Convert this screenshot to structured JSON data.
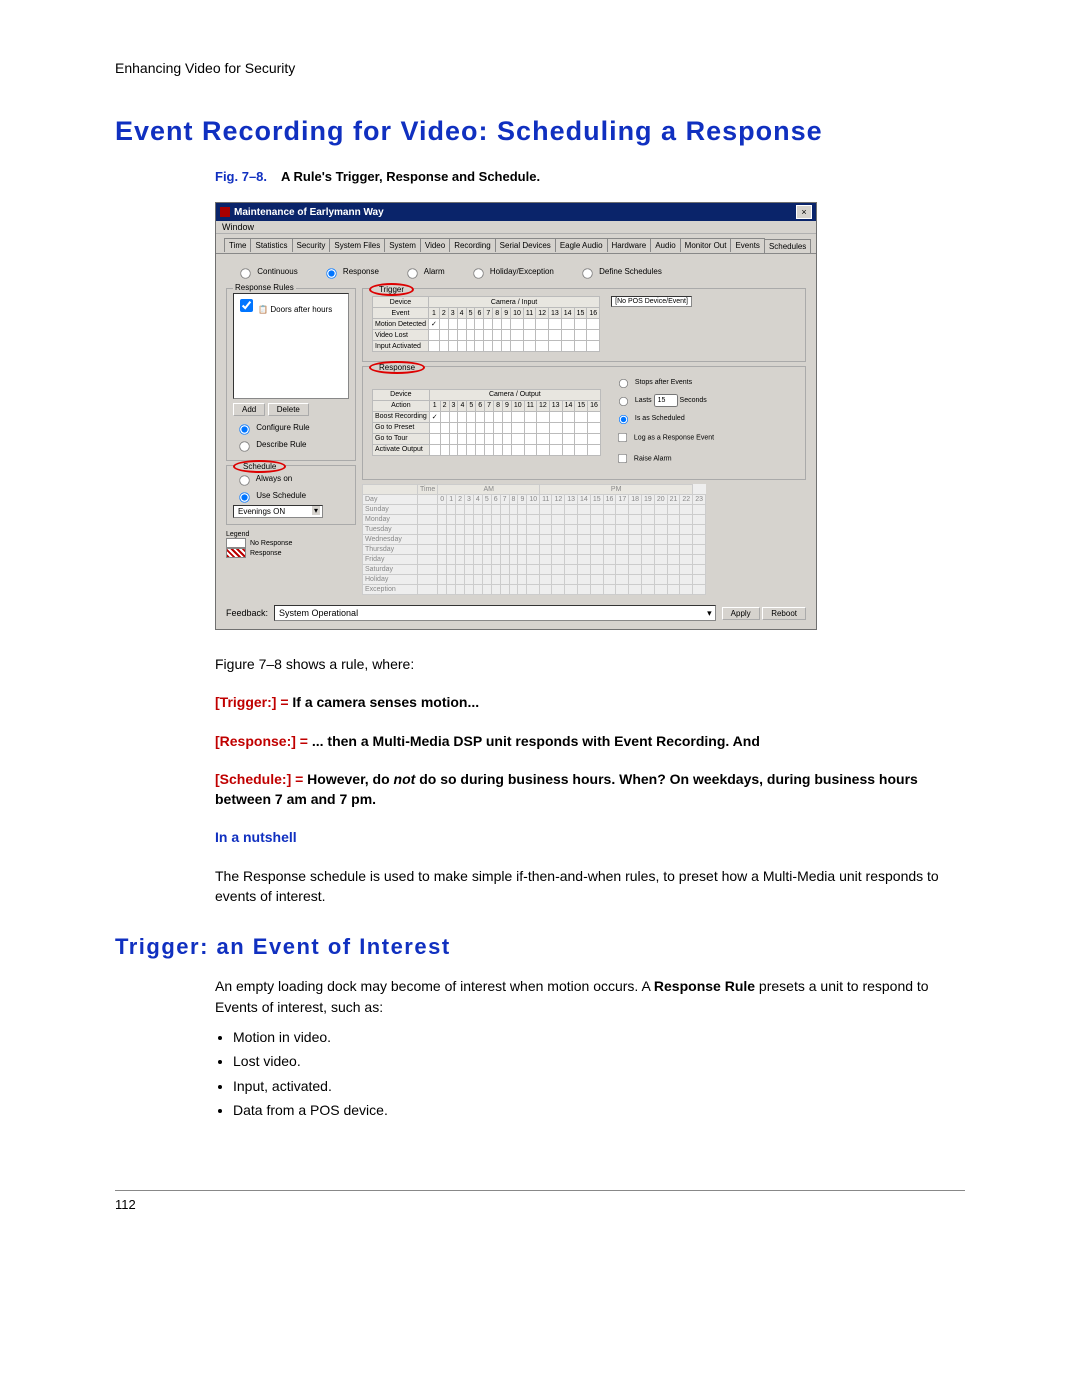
{
  "doc": {
    "header": "Enhancing Video for Security",
    "page_number": "112",
    "h1": "Event Recording for Video: Scheduling a Response",
    "fig_label": "Fig. 7–8.",
    "fig_title": "A Rule's Trigger, Response and Schedule.",
    "intro_line": "Figure 7–8 shows a rule, where:",
    "trigger_label": "[Trigger:] =",
    "trigger_text": " If a camera senses motion...",
    "response_label": "[Response:] =",
    "response_text": " ... then a Multi-Media DSP unit responds with Event Recording. And",
    "schedule_label": "[Schedule:] =",
    "schedule_text_before": " However, do ",
    "schedule_not": "not",
    "schedule_text_after": " do so during business hours. When? On weekdays, during business hours between 7 am and 7 pm.",
    "nutshell_heading": "In a nutshell",
    "nutshell_para": "The Response schedule is used to make simple if-then-and-when rules, to preset how a Multi-Media unit responds to events of interest.",
    "h2": "Trigger: an Event of Interest",
    "trigger_para_before": "An empty loading dock may become of interest when motion occurs. A ",
    "trigger_para_bold": "Response Rule",
    "trigger_para_after": "  presets a unit to respond to Events of interest, such as:",
    "bullets": [
      "Motion in video.",
      "Lost video.",
      "Input, activated.",
      "Data from a POS device."
    ]
  },
  "shot": {
    "title": "Maintenance of Earlymann Way",
    "menu": "Window",
    "tabs": [
      "Time",
      "Statistics",
      "Security",
      "System Files",
      "System",
      "Video",
      "Recording",
      "Serial Devices",
      "Eagle Audio",
      "Hardware",
      "Audio",
      "Monitor Out",
      "Events",
      "Schedules"
    ],
    "active_tab": "Schedules",
    "sched_radios": [
      "Continuous",
      "Response",
      "Alarm",
      "Holiday/Exception",
      "Define Schedules"
    ],
    "sched_selected": "Response",
    "rules_box_label": "Response Rules",
    "rule_item": "Doors after hours",
    "btn_add": "Add",
    "btn_delete": "Delete",
    "rule_radios": {
      "configure": "Configure Rule",
      "describe": "Describe Rule",
      "selected": "configure"
    },
    "trigger_box_label": "Trigger",
    "trig_device": "Device",
    "trig_cam": "Camera / Input",
    "no_pos": "[No POS Device/Event]",
    "trig_event_col": "Event",
    "trig_events": [
      "Motion Detected",
      "Video Lost",
      "Input Activated"
    ],
    "trig_check_col": 1,
    "response_box_label": "Response",
    "resp_device": "Device",
    "resp_cam": "Camera / Output",
    "resp_action_col": "Action",
    "resp_actions": [
      "Boost Recording",
      "Go to Preset",
      "Go to Tour",
      "Activate Output"
    ],
    "resp_check_col": 1,
    "resp_opts": {
      "stops": "Stops after Events",
      "lasts": "Lasts",
      "lasts_val": "15",
      "lasts_unit": "Seconds",
      "assched": "Is as Scheduled",
      "selected": "assched",
      "log": "Log as a Response Event",
      "raise": "Raise Alarm"
    },
    "schedule_box_label": "Schedule",
    "sched_opts": {
      "always": "Always on",
      "use": "Use Schedule",
      "selected": "use"
    },
    "sched_select_value": "Evenings ON",
    "sched_time_header": "Time",
    "am": "AM",
    "pm": "PM",
    "hours": [
      "0",
      "1",
      "2",
      "3",
      "4",
      "5",
      "6",
      "7",
      "8",
      "9",
      "10",
      "11",
      "12",
      "13",
      "14",
      "15",
      "16",
      "17",
      "18",
      "19",
      "20",
      "21",
      "22",
      "23"
    ],
    "day_col": "Day",
    "days": [
      "Sunday",
      "Monday",
      "Tuesday",
      "Wednesday",
      "Thursday",
      "Friday",
      "Saturday",
      "Holiday",
      "Exception"
    ],
    "legend_label": "Legend",
    "legend_nores": "No Response",
    "legend_res": "Response",
    "feedback_label": "Feedback:",
    "feedback_value": "System Operational",
    "btn_apply": "Apply",
    "btn_reboot": "Reboot",
    "cols16": [
      "1",
      "2",
      "3",
      "4",
      "5",
      "6",
      "7",
      "8",
      "9",
      "10",
      "11",
      "12",
      "13",
      "14",
      "15",
      "16"
    ]
  }
}
